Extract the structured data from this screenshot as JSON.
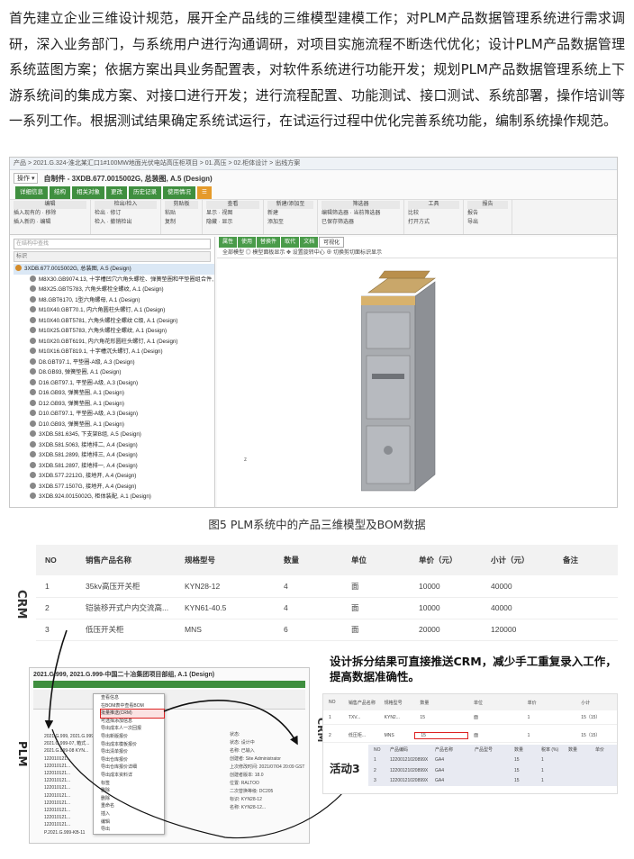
{
  "paragraph": "首先建立企业三维设计规范，展开全产品线的三维模型建模工作；对PLM产品数据管理系统进行需求调研，深入业务部门，与系统用户进行沟通调研，对项目实施流程不断迭代优化；设计PLM产品数据管理系统蓝图方案；依据方案出具业务配置表，对软件系统进行功能开发；规划PLM产品数据管理系统上下游系统间的集成方案、对接口进行开发；进行流程配置、功能测试、接口测试、系统部署，操作培训等一系列工作。根据测试结果确定系统试运行，在试运行过程中优化完善系统功能，编制系统操作规范。",
  "figure5": {
    "breadcrumb": "产品 > 2021.G.324-淮北某汇口1#100MW地面光伏电站高压柜项目 > 01.高压 > 02.柜体设计 > 出线方案",
    "ops": "操作 ▾",
    "title": "自制件 - 3XDB.677.0015002G, 总装图, A.5 (Design)",
    "tabs": [
      "详细信息",
      "结构",
      "相关对象",
      "更改",
      "历史记录",
      "使用情况"
    ],
    "ribbon_groups": [
      {
        "title": "编辑",
        "items": [
          "插入现有的",
          "移除",
          "插入新的",
          "编辑"
        ]
      },
      {
        "title": "检出/检入",
        "items": [
          "检出",
          "修订",
          "检入",
          "撤销检出"
        ]
      },
      {
        "title": "剪贴板",
        "items": [
          "粘贴",
          "复制"
        ]
      },
      {
        "title": "查看",
        "items": [
          "显示",
          "视图",
          "隐藏",
          "显示"
        ]
      },
      {
        "title": "新建/添加至",
        "items": [
          "新建",
          "添加至"
        ]
      },
      {
        "title": "筛选器",
        "items": [
          "编辑筛选器",
          "当前筛选器",
          "已保存筛选器"
        ]
      },
      {
        "title": "工具",
        "items": [
          "比较",
          "打开方式"
        ]
      },
      {
        "title": "报告",
        "items": [
          "报告",
          "导出"
        ]
      }
    ],
    "search_placeholder": "在结构中查找",
    "column_header": "标识",
    "tree": [
      "3XDB.677.0015002G, 总装图, A.5 (Design)",
      "M8X30.GB9074.13, 十字槽凹穴六角头螺栓、弹簧垫圈和平垫圈组合件, A",
      "M8X25.GBT5783, 六角头螺栓全螺纹, A.1 (Design)",
      "M8.GBT6170, 1型六角螺母, A.1 (Design)",
      "M10X40.GBT70.1, 内六角圆柱头螺钉, A.1 (Design)",
      "M10X40.GBT5781, 六角头螺栓全螺纹 C级, A.1 (Design)",
      "M10X25.GBT5783, 六角头螺栓全螺纹, A.1 (Design)",
      "M10X20.GBT6191, 内六角花形圆柱头螺钉, A.1 (Design)",
      "M10X16.GBT819.1, 十字槽沉头螺钉, A.1 (Design)",
      "D8.GBT97.1, 平垫圈-A级, A.3 (Design)",
      "D8.GB93, 弹簧垫圈, A.1 (Design)",
      "D16.GBT97.1, 平垫圈-A级, A.3 (Design)",
      "D16.GB93, 弹簧垫圈, A.1 (Design)",
      "D12.GB93, 弹簧垫圈, A.1 (Design)",
      "D10.GBT97.1, 平垫圈-A级, A.3 (Design)",
      "D10.GB93, 弹簧垫圈, A.1 (Design)",
      "3XDB.581.6345, 下支架B组, A.5 (Design)",
      "3XDB.581.5063, 接地排二, A.4 (Design)",
      "3XDB.581.2899, 接地排三, A.4 (Design)",
      "3XDB.581.2897, 接地排一, A.4 (Design)",
      "3XDB.577.2212G, 接地开, A.4 (Design)",
      "3XDB.577.1507G, 接地开, A.4 (Design)",
      "3XDB.924.0015002G, 柜体装配, A.1 (Design)"
    ],
    "view_tabs": [
      "属性",
      "使用",
      "替换件",
      "取代",
      "文档",
      "可视化"
    ],
    "view_tools": "全部模型  ◎ 模型面板显示  ✥ 设置旋转中心  ⊕ 切换剪切面标识显示",
    "axis_label": "z",
    "caption": "图5 PLM系统中的产品三维模型及BOM数据"
  },
  "crm_table": {
    "side_label": "CRM",
    "columns": [
      "NO",
      "销售产品名称",
      "规格型号",
      "数量",
      "单位",
      "单价（元）",
      "小计（元）",
      "备注"
    ],
    "rows": [
      [
        "1",
        "35kv高压开关柜",
        "KYN28-12",
        "4",
        "面",
        "10000",
        "40000",
        ""
      ],
      [
        "2",
        "铠装移开式户内交流高...",
        "KYN61-40.5",
        "4",
        "面",
        "10000",
        "40000",
        ""
      ],
      [
        "3",
        "低压开关柜",
        "MNS",
        "6",
        "面",
        "20000",
        "120000",
        ""
      ]
    ]
  },
  "plm_mini": {
    "side_label": "PLM",
    "title": "2021.G.999, 2021.G.999-中国二十冶集团项目部组, A.1 (Design)",
    "menu": [
      "查看信息",
      "在BOM表中查看BOM",
      "批量推送(CRM)",
      "可选择添加信息",
      "导出成本人一次回报",
      "导出新版报价",
      "导出成本模板报价",
      "导出清单报价",
      "导出仓库报价",
      "导出仓库报价详细",
      "导出成本资料详",
      "标签",
      "删除",
      "删除",
      "重命名",
      "插入",
      "编辑",
      "导出"
    ],
    "tree": [
      "2021.G.999, 2021.G.999-中国...",
      "2021.G.999-07, 箱式...",
      "2021.G.999-08 KYN...",
      "122010121...",
      "122010121...",
      "122010121...",
      "122010121...",
      "122010121...",
      "122010121...",
      "122010121...",
      "122010121...",
      "122010121...",
      "122010121...",
      "P.2021.G.999-KB-11"
    ],
    "props": [
      "状态:",
      "状态: 设计中",
      "名称: 已输入",
      "创建者: Site Administrator",
      "上次修改时间: 2021/07/04 20:09 GST",
      "创建者版本: 18.0",
      "位置: RALTOO",
      "二次替换等级: DC205",
      "标识: KYN28-12",
      "名称: KYN28-12..."
    ]
  },
  "note": "设计拆分结果可直接推送CRM，减少手工重复录入工作，提高数据准确性。",
  "crm_mini": {
    "side_label": "CRM",
    "header": [
      "NO",
      "销售产品名称",
      "规格型号",
      "数量",
      "单位",
      "单价",
      "小计"
    ],
    "rows": [
      [
        "1",
        "TXV...",
        "KYN2...",
        "15",
        "面",
        "1",
        "15（15）"
      ],
      [
        "2",
        "低压柜...",
        "MNS",
        "15",
        "面",
        "1",
        "15（15）"
      ]
    ],
    "sub_header": [
      "NO",
      "产品编码",
      "产品名称",
      "产品型号",
      "数量",
      "税率 (%)",
      "数量",
      "单价"
    ],
    "sub_rows": [
      [
        "1",
        "12200121020899X",
        "GA4",
        "",
        "15",
        "1"
      ],
      [
        "2",
        "12200121020899X",
        "GA4",
        "",
        "15",
        "1"
      ],
      [
        "3",
        "12200121020899X",
        "GA4",
        "",
        "15",
        "1"
      ]
    ]
  },
  "activity_label": "活动3"
}
